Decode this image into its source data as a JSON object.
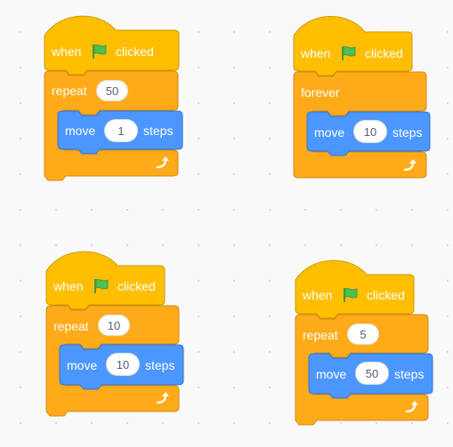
{
  "colors": {
    "events": "#ffbf00",
    "events_border": "#cc9900",
    "control": "#ffab19",
    "control_border": "#cf8b17",
    "motion": "#4c97ff",
    "motion_border": "#3373cc",
    "flag_green": "#4cbf56",
    "flag_dark": "#45993d"
  },
  "icons": {
    "flag": "green-flag-icon",
    "loop": "repeat-arrow-icon"
  },
  "scripts": [
    {
      "hat": {
        "when": "when",
        "clicked": "clicked"
      },
      "loop": {
        "keyword": "repeat",
        "count": "50"
      },
      "move": {
        "label": "move",
        "value": "1",
        "unit": "steps"
      }
    },
    {
      "hat": {
        "when": "when",
        "clicked": "clicked"
      },
      "loop": {
        "keyword": "forever"
      },
      "move": {
        "label": "move",
        "value": "10",
        "unit": "steps"
      }
    },
    {
      "hat": {
        "when": "when",
        "clicked": "clicked"
      },
      "loop": {
        "keyword": "repeat",
        "count": "10"
      },
      "move": {
        "label": "move",
        "value": "10",
        "unit": "steps"
      }
    },
    {
      "hat": {
        "when": "when",
        "clicked": "clicked"
      },
      "loop": {
        "keyword": "repeat",
        "count": "5"
      },
      "move": {
        "label": "move",
        "value": "50",
        "unit": "steps"
      }
    }
  ]
}
